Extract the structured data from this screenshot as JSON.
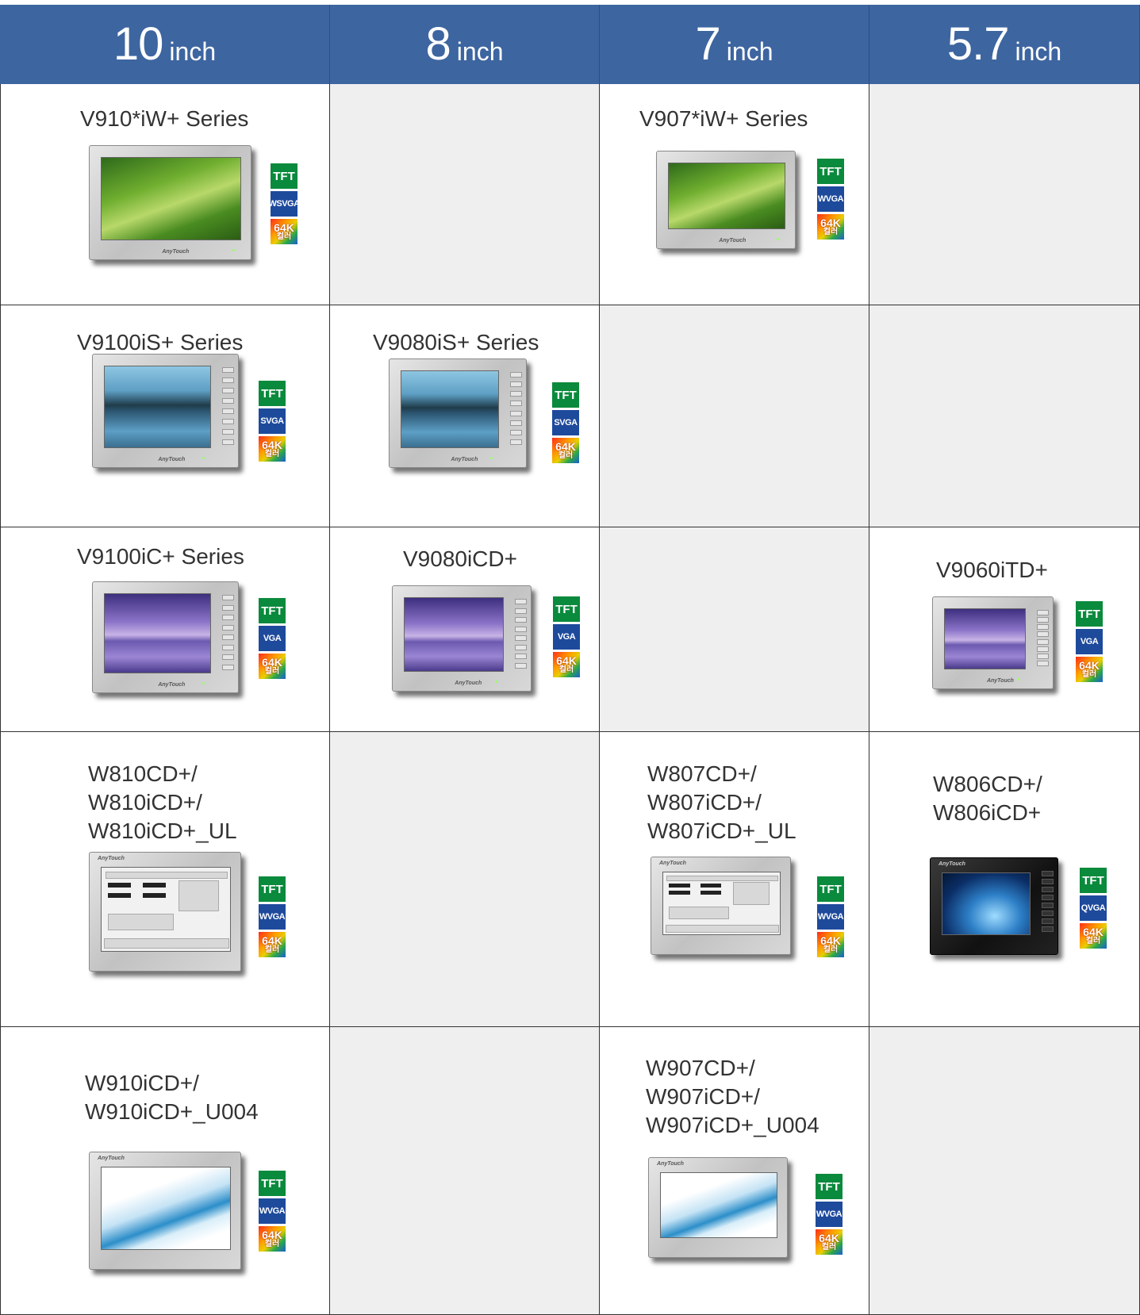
{
  "headers": [
    {
      "size": "10",
      "unit": "inch"
    },
    {
      "size": "8",
      "unit": "inch"
    },
    {
      "size": "7",
      "unit": "inch"
    },
    {
      "size": "5.7",
      "unit": "inch"
    }
  ],
  "rows": [
    [
      {
        "title": "V910*iW+ Series",
        "screen": "leaf",
        "keys": false,
        "display": "TFT",
        "resolution": "WSVGA",
        "colors": "64K",
        "colors_label": "컬러",
        "brand": "AnyTouch"
      },
      null,
      {
        "title": "V907*iW+ Series",
        "screen": "leaf",
        "keys": false,
        "display": "TFT",
        "resolution": "WVGA",
        "colors": "64K",
        "colors_label": "컬러",
        "brand": "AnyTouch"
      },
      null
    ],
    [
      {
        "title": "V9100iS+ Series",
        "screen": "lake",
        "keys": true,
        "display": "TFT",
        "resolution": "SVGA",
        "colors": "64K",
        "colors_label": "컬러",
        "brand": "AnyTouch"
      },
      {
        "title": "V9080iS+ Series",
        "screen": "lake",
        "keys": true,
        "display": "TFT",
        "resolution": "SVGA",
        "colors": "64K",
        "colors_label": "컬러",
        "brand": "AnyTouch"
      },
      null,
      null
    ],
    [
      {
        "title": "V9100iC+ Series",
        "screen": "purple",
        "keys": true,
        "display": "TFT",
        "resolution": "VGA",
        "colors": "64K",
        "colors_label": "컬러",
        "brand": "AnyTouch"
      },
      {
        "title": "V9080iCD+",
        "screen": "purple",
        "keys": true,
        "display": "TFT",
        "resolution": "VGA",
        "colors": "64K",
        "colors_label": "컬러",
        "brand": "AnyTouch"
      },
      null,
      {
        "title": "V9060iTD+",
        "screen": "purple",
        "keys": true,
        "display": "TFT",
        "resolution": "VGA",
        "colors": "64K",
        "colors_label": "컬러",
        "brand": "AnyTouch"
      }
    ],
    [
      {
        "title": "W810CD+/\nW810iCD+/\nW810iCD+_UL",
        "screen": "ui",
        "keys": false,
        "display": "TFT",
        "resolution": "WVGA",
        "colors": "64K",
        "colors_label": "컬러",
        "brand": "AnyTouch"
      },
      null,
      {
        "title": "W807CD+/\nW807iCD+/\nW807iCD+_UL",
        "screen": "ui",
        "keys": false,
        "display": "TFT",
        "resolution": "WVGA",
        "colors": "64K",
        "colors_label": "컬러",
        "brand": "AnyTouch"
      },
      {
        "title": "W806CD+/\nW806iCD+",
        "screen": "net",
        "keys": true,
        "dark": true,
        "display": "TFT",
        "resolution": "QVGA",
        "colors": "64K",
        "colors_label": "컬러",
        "brand": "AnyTouch"
      }
    ],
    [
      {
        "title": "W910iCD+/\nW910iCD+_U004",
        "screen": "wave",
        "keys": false,
        "display": "TFT",
        "resolution": "WVGA",
        "colors": "64K",
        "colors_label": "컬러",
        "brand": "AnyTouch"
      },
      null,
      {
        "title": "W907CD+/\nW907iCD+/\nW907iCD+_U004",
        "screen": "wave",
        "keys": false,
        "display": "TFT",
        "resolution": "WVGA",
        "colors": "64K",
        "colors_label": "컬러",
        "brand": "AnyTouch"
      },
      null
    ]
  ]
}
